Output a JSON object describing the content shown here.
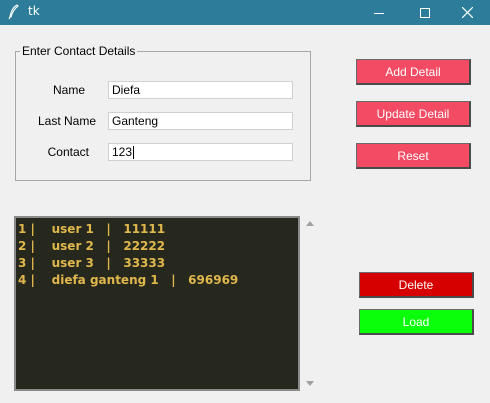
{
  "window": {
    "title": "tk"
  },
  "form": {
    "legend": "Enter Contact Details",
    "name_label": "Name",
    "name_value": "Diefa",
    "lastname_label": "Last Name",
    "lastname_value": "Ganteng",
    "contact_label": "Contact",
    "contact_value": "123"
  },
  "buttons": {
    "add": "Add Detail",
    "update": "Update Detail",
    "reset": "Reset",
    "delete": "Delete",
    "load": "Load"
  },
  "listbox": {
    "rows": [
      "1 |    user 1   |   11111",
      "2 |    user 2   |   22222",
      "3 |    user 3   |   33333",
      "4 |    diefa ganteng 1   |   696969"
    ]
  },
  "colors": {
    "titlebar": "#2d7d9a",
    "pink_button": "#f24b63",
    "delete_button": "#d60000",
    "load_button": "#0aff0a",
    "listbox_bg": "#26281d",
    "listbox_text": "#e0b74c"
  }
}
